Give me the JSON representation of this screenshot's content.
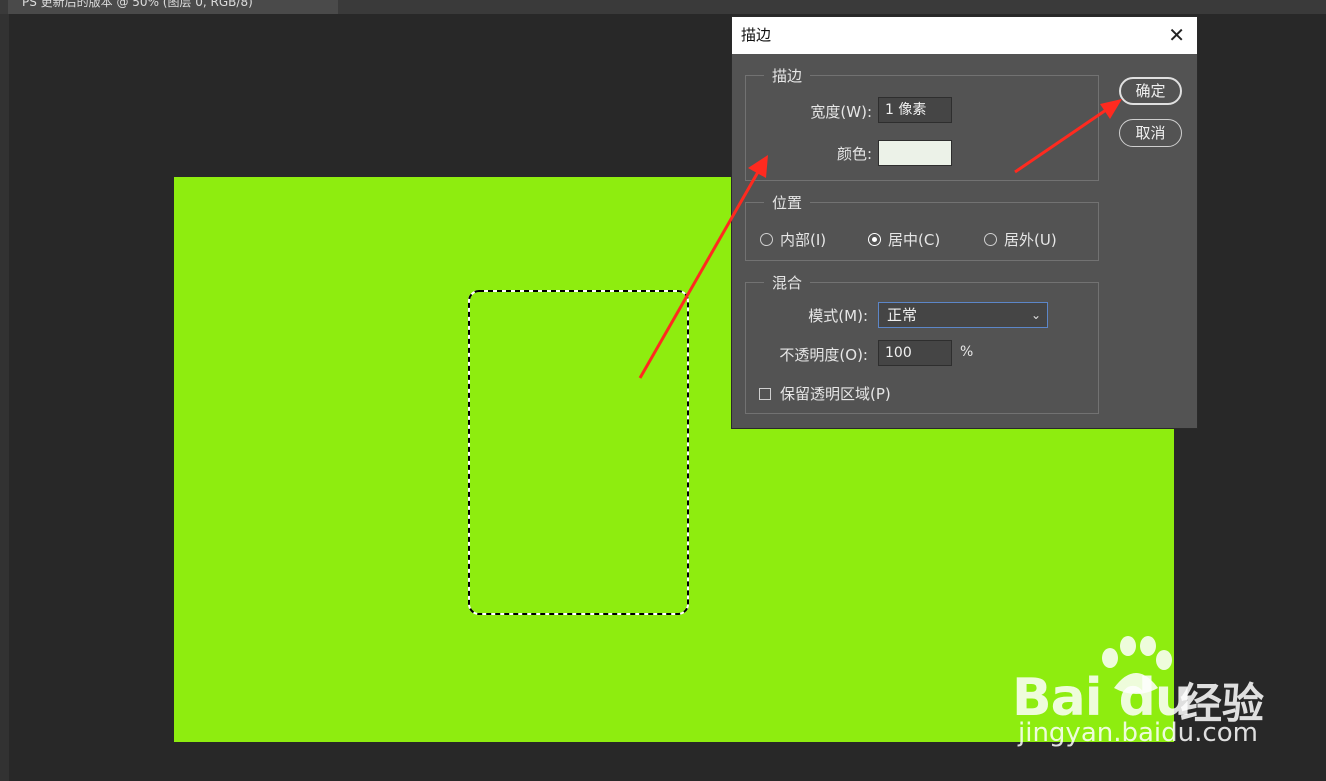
{
  "document_tab": {
    "title": "PS 更新后的版本 @ 50% (图层 0, RGB/8)"
  },
  "colors": {
    "canvas": "#8eed0f",
    "stroke_swatch": "#ecf2e8",
    "arrow": "#ff2a1f",
    "dialog_bg": "#535353"
  },
  "dialog": {
    "title": "描边",
    "close_label": "✕",
    "stroke_group": {
      "legend": "描边",
      "width_label": "宽度(W):",
      "width_value": "1 像素",
      "color_label": "颜色:"
    },
    "position_group": {
      "legend": "位置",
      "options": [
        {
          "label": "内部(I)",
          "selected": false
        },
        {
          "label": "居中(C)",
          "selected": true
        },
        {
          "label": "居外(U)",
          "selected": false
        }
      ]
    },
    "blend_group": {
      "legend": "混合",
      "mode_label": "模式(M):",
      "mode_value": "正常",
      "opacity_label": "不透明度(O):",
      "opacity_value": "100",
      "opacity_unit": "%",
      "preserve_label": "保留透明区域(P)"
    },
    "ok_label": "确定",
    "cancel_label": "取消"
  },
  "watermark": {
    "logo": "Bai du",
    "cn": "经验",
    "url": "jingyan.baidu.com"
  }
}
